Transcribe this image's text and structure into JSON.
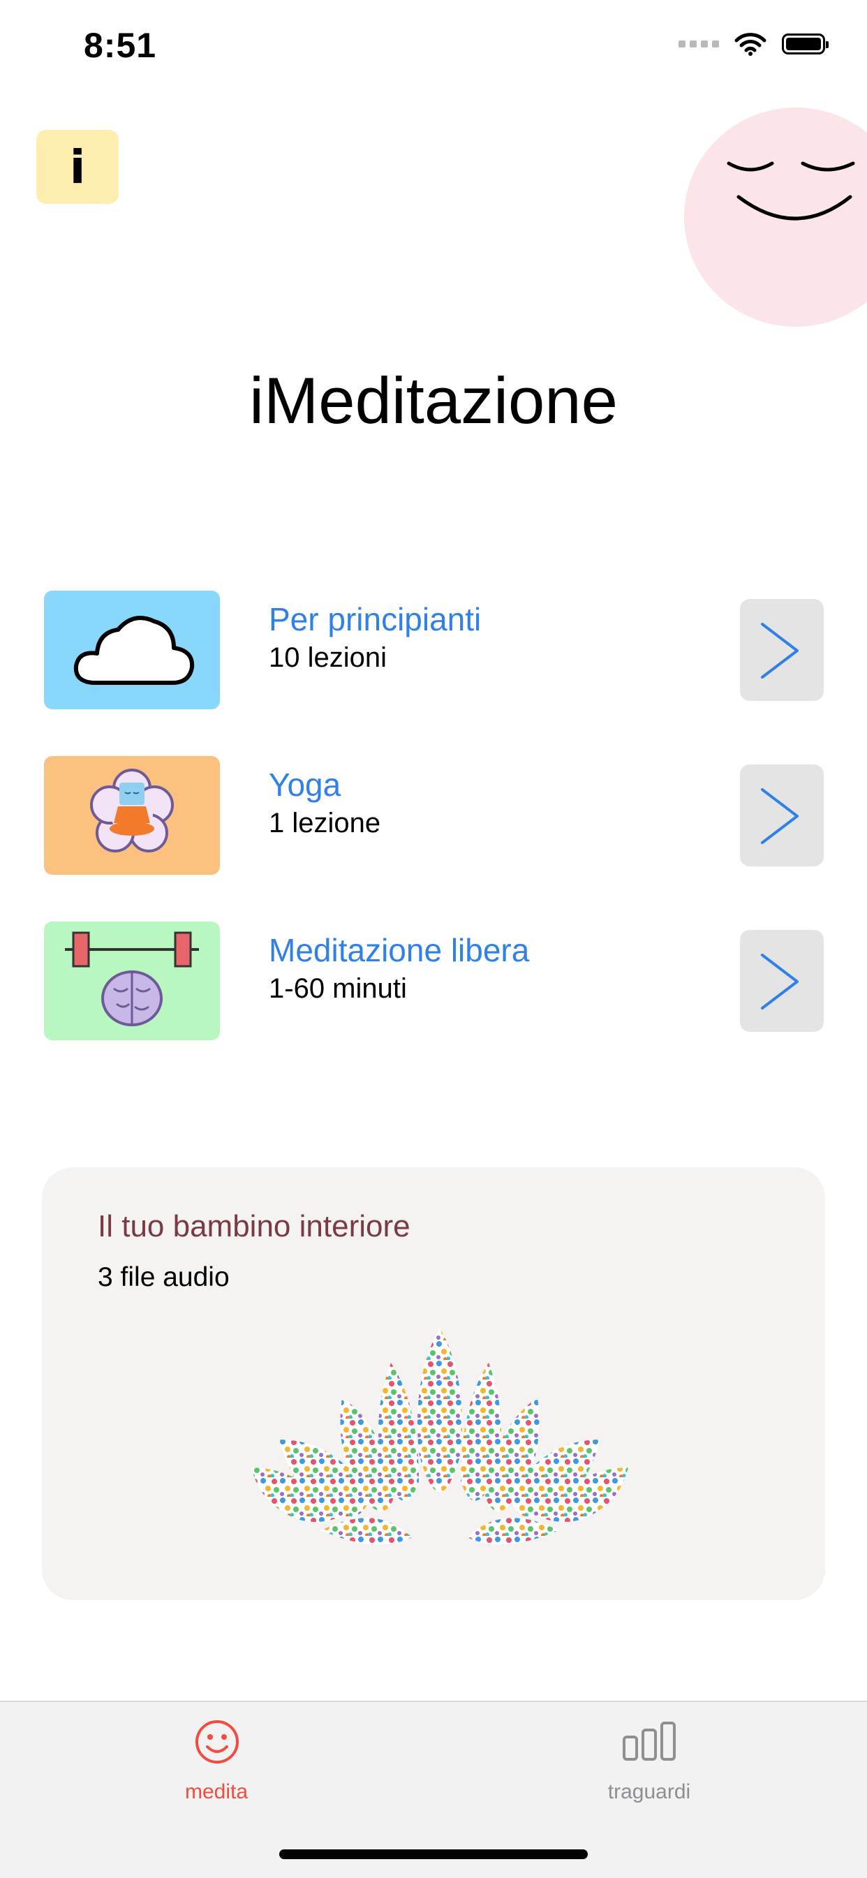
{
  "status": {
    "time": "8:51"
  },
  "app": {
    "title": "iMeditazione",
    "info_label": "i"
  },
  "courses": [
    {
      "title": "Per principianti",
      "subtitle": "10 lezioni",
      "color": "#89d8fb"
    },
    {
      "title": "Yoga",
      "subtitle": "1 lezione",
      "color": "#fcc17f"
    },
    {
      "title": "Meditazione libera",
      "subtitle": "1-60 minuti",
      "color": "#b8f7c0"
    }
  ],
  "featured": {
    "title": "Il tuo bambino interiore",
    "subtitle": "3 file audio"
  },
  "tabs": [
    {
      "label": "medita",
      "icon": "smiley-icon",
      "active": true,
      "color": "#f24b3f"
    },
    {
      "label": "traguardi",
      "icon": "bar-chart-icon",
      "active": false,
      "color": "#8e8e93"
    }
  ],
  "colors": {
    "accent": "#2f80e7",
    "active_tab": "#f24b3f",
    "inactive_tab": "#8e8e93"
  }
}
